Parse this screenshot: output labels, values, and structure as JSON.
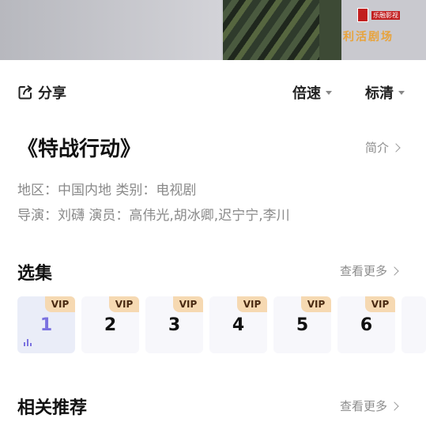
{
  "video": {
    "watermark_logo_text": "乐融影视",
    "watermark_text": "利活剧场"
  },
  "actions": {
    "share_label": "分享",
    "speed_label": "倍速",
    "quality_label": "标清"
  },
  "show": {
    "title": "《特战行动》",
    "intro_label": "简介",
    "meta_line1": "地区：中国内地 类别：电视剧",
    "meta_line2": "导演：刘礴 演员：高伟光,胡冰卿,迟宁宁,李川"
  },
  "episodes": {
    "title": "选集",
    "more_label": "查看更多",
    "items": [
      {
        "number": "1",
        "badge": "VIP",
        "active": true
      },
      {
        "number": "2",
        "badge": "VIP",
        "active": false
      },
      {
        "number": "3",
        "badge": "VIP",
        "active": false
      },
      {
        "number": "4",
        "badge": "VIP",
        "active": false
      },
      {
        "number": "5",
        "badge": "VIP",
        "active": false
      },
      {
        "number": "6",
        "badge": "VIP",
        "active": false
      }
    ]
  },
  "recommend": {
    "title": "相关推荐",
    "more_label": "查看更多"
  },
  "colors": {
    "accent": "#7b72e0",
    "vip_badge": "#f6d9b2",
    "muted_text": "#8a8a8a"
  }
}
